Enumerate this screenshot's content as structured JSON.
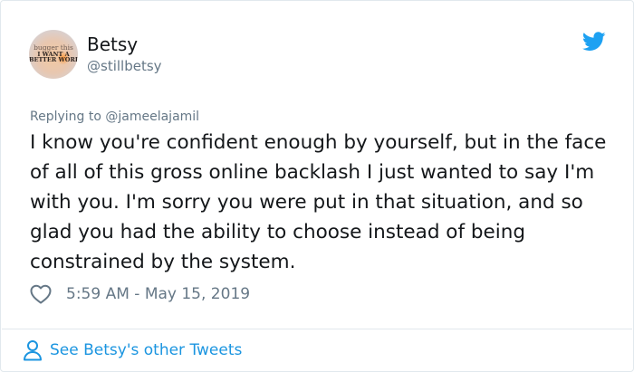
{
  "author": {
    "display_name": "Betsy",
    "handle": "@stillbetsy",
    "avatar_text": {
      "line1": "bugger this",
      "line2": "I WANT A",
      "line3": "BETTER WORLD"
    }
  },
  "reply": {
    "text": "Replying to @jameelajamil"
  },
  "tweet": {
    "text": "I know you're confident enough by yourself, but in the face of all of this gross online backlash I just wanted to say I'm with you. I'm sorry you were put in that situation, and so glad you had the ability to choose instead of being constrained by the system.",
    "timestamp": "5:59 AM - May 15, 2019"
  },
  "footer": {
    "link_label": "See Betsy's other Tweets"
  },
  "icons": {
    "brand": "twitter-bird-icon",
    "like": "heart-icon",
    "profile": "person-icon"
  },
  "colors": {
    "brand": "#1da1f2",
    "link": "#1b95e0",
    "muted": "#657786",
    "text": "#14171a",
    "border": "#e1e8ed"
  }
}
